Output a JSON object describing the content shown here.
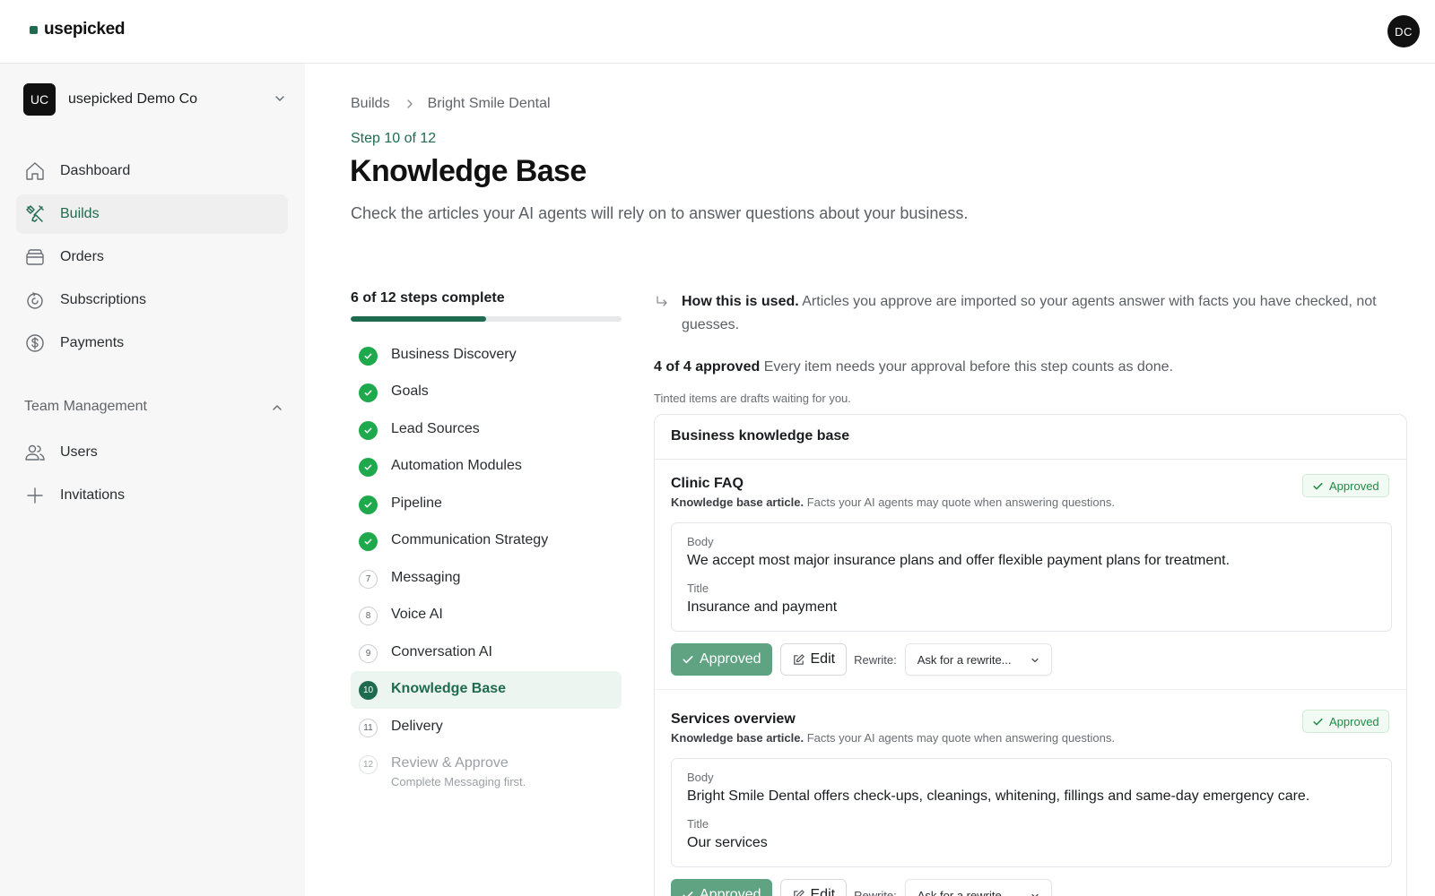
{
  "app": {
    "logo_text": "usepicked",
    "user_initials": "DC"
  },
  "sidebar": {
    "org": {
      "initials": "UC",
      "name": "usepicked Demo Co"
    },
    "nav": [
      {
        "label": "Dashboard",
        "icon": "home-icon"
      },
      {
        "label": "Builds",
        "icon": "tools-icon",
        "active": true
      },
      {
        "label": "Orders",
        "icon": "box-icon"
      },
      {
        "label": "Subscriptions",
        "icon": "refresh-icon"
      },
      {
        "label": "Payments",
        "icon": "dollar-icon"
      }
    ],
    "team_section": {
      "title": "Team Management",
      "items": [
        {
          "label": "Users",
          "icon": "users-icon"
        },
        {
          "label": "Invitations",
          "icon": "plus-icon"
        }
      ]
    }
  },
  "main": {
    "breadcrumb": [
      "Builds",
      "Bright Smile Dental"
    ],
    "step_label": "Step 10 of 12",
    "title": "Knowledge Base",
    "subtitle": "Check the articles your AI agents will rely on to answer questions about your business.",
    "steps_panel": {
      "summary": "6 of 12 steps complete",
      "progress_fraction": 0.5,
      "steps": [
        {
          "num": "1",
          "label": "Business Discovery",
          "state": "done"
        },
        {
          "num": "2",
          "label": "Goals",
          "state": "done"
        },
        {
          "num": "3",
          "label": "Lead Sources",
          "state": "done"
        },
        {
          "num": "4",
          "label": "Automation Modules",
          "state": "done"
        },
        {
          "num": "5",
          "label": "Pipeline",
          "state": "done"
        },
        {
          "num": "6",
          "label": "Communication Strategy",
          "state": "done"
        },
        {
          "num": "7",
          "label": "Messaging",
          "state": "todo"
        },
        {
          "num": "8",
          "label": "Voice AI",
          "state": "todo"
        },
        {
          "num": "9",
          "label": "Conversation AI",
          "state": "todo"
        },
        {
          "num": "10",
          "label": "Knowledge Base",
          "state": "current"
        },
        {
          "num": "11",
          "label": "Delivery",
          "state": "todo"
        },
        {
          "num": "12",
          "label": "Review & Approve",
          "state": "disabled",
          "note": "Complete Messaging first."
        }
      ]
    },
    "info": {
      "strong": "How this is used.",
      "text": "Articles you approve are imported so your agents answer with facts you have checked, not guesses."
    },
    "approval": {
      "strong": "4 of 4 approved",
      "text": "Every item needs your approval before this step counts as done.",
      "note": "Tinted items are drafts waiting for you."
    },
    "kb_card": {
      "title": "Business knowledge base",
      "articles": [
        {
          "title": "Clinic FAQ",
          "sub_strong": "Knowledge base article.",
          "sub_text": "Facts your AI agents may quote when answering questions.",
          "badge": "Approved",
          "body_label": "Body",
          "body": "We accept most major insurance plans and offer flexible payment plans for treatment.",
          "title_label": "Title",
          "title_value": "Insurance and payment",
          "approved_btn": "Approved",
          "edit_btn": "Edit",
          "rewrite_label": "Rewrite:",
          "rewrite_placeholder": "Ask for a rewrite..."
        },
        {
          "title": "Services overview",
          "sub_strong": "Knowledge base article.",
          "sub_text": "Facts your AI agents may quote when answering questions.",
          "badge": "Approved",
          "body_label": "Body",
          "body": "Bright Smile Dental offers check-ups, cleanings, whitening, fillings and same-day emergency care.",
          "title_label": "Title",
          "title_value": "Our services",
          "approved_btn": "Approved",
          "edit_btn": "Edit",
          "rewrite_label": "Rewrite:",
          "rewrite_placeholder": "Ask for a rewrite..."
        }
      ]
    }
  },
  "colors": {
    "brand": "#1f6b4f",
    "done": "#1fa94d",
    "approved_button": "#5fa383"
  }
}
